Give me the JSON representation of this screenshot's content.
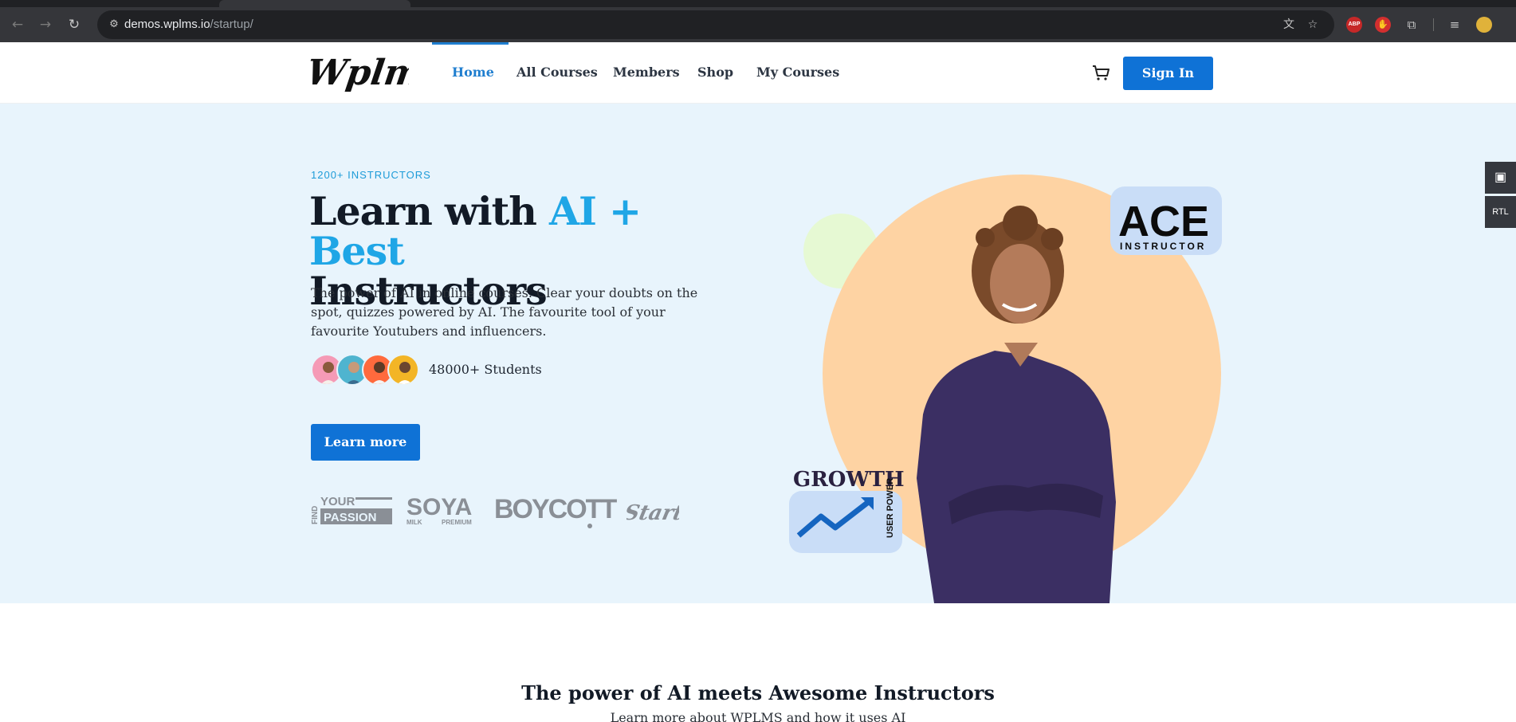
{
  "browser": {
    "url_host": "demos.wplms.io",
    "url_path": "/startup/"
  },
  "header": {
    "logo_text": "Wplms",
    "nav": [
      {
        "label": "Home",
        "active": true
      },
      {
        "label": "All Courses"
      },
      {
        "label": "Members"
      },
      {
        "label": "Shop"
      },
      {
        "label": "My Courses"
      }
    ],
    "signin_label": "Sign In"
  },
  "hero": {
    "eyebrow": "1200+ INSTRUCTORS",
    "headline_part1": "Learn with ",
    "headline_accent": "AI + Best",
    "headline_part2": "Instructors",
    "lede": "The power of AI in online courses. Clear your doubts on the spot, quizzes powered by AI. The favourite tool of your favourite Youtubers and influencers.",
    "students_label": "48000+ Students",
    "cta_label": "Learn more",
    "brands": [
      "FIND YOUR PASSION",
      "SOYA MILK PREMIUM",
      "BOYCOTT",
      "Start"
    ],
    "badge_ace": "ACE",
    "badge_ace_sub": "INSTRUCTOR",
    "badge_growth": "GROWTH",
    "badge_growth_sub": "USER POWER"
  },
  "side_tools": {
    "rtl_label": "RTL"
  },
  "section": {
    "title": "The power of AI meets Awesome Instructors",
    "subtitle": "Learn more about WPLMS and how it uses AI"
  },
  "colors": {
    "accent": "#1fa6e6",
    "primary_button": "#0f72d6",
    "hero_bg": "#e8f4fc",
    "circle": "#fed3a3"
  }
}
